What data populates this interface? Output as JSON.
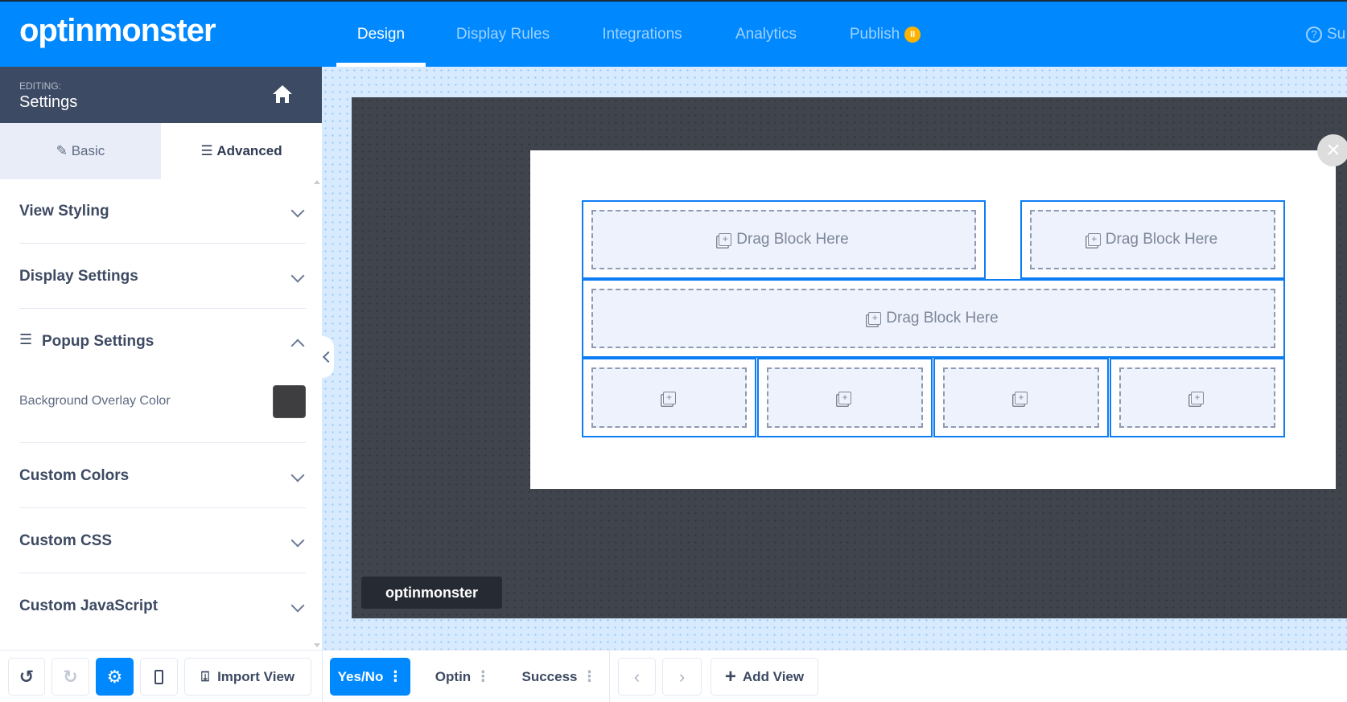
{
  "header": {
    "logo": "optinmonster",
    "nav": [
      {
        "label": "Design",
        "active": true
      },
      {
        "label": "Display Rules"
      },
      {
        "label": "Integrations"
      },
      {
        "label": "Analytics"
      },
      {
        "label": "Publish",
        "badge": "pause-icon"
      }
    ],
    "help": "Su"
  },
  "sidebar": {
    "editing_label": "EDITING:",
    "editing_title": "Settings",
    "tabs": {
      "basic": "Basic",
      "advanced": "Advanced"
    },
    "sections": [
      "View Styling",
      "Display Settings",
      "Popup Settings",
      "Custom Colors",
      "Custom CSS",
      "Custom JavaScript"
    ],
    "overlay_label": "Background Overlay Color",
    "overlay_color": "#3e3e40"
  },
  "canvas": {
    "drag_label": "Drag Block Here",
    "brand": "optinmonster",
    "close": "×"
  },
  "bottom": {
    "import": "Import View",
    "views": [
      "Yes/No",
      "Optin",
      "Success"
    ],
    "add_view": "Add View"
  },
  "colors": {
    "accent": "#0088ff",
    "sidebar_header": "#3d4a63",
    "stage": "#40444c",
    "block_border": "#0d7df5"
  }
}
